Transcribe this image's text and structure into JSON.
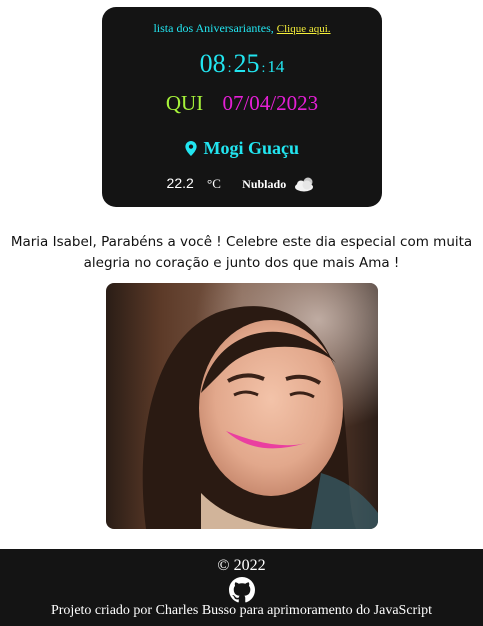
{
  "card": {
    "list_text": "lista dos Aniversariantes,",
    "list_link": "Clique aqui.",
    "clock": {
      "hours": "08",
      "minutes": "25",
      "seconds": "14",
      "separator": ":"
    },
    "weekday": "QUI",
    "date": "07/04/2023",
    "city": "Mogi Guaçu",
    "weather": {
      "temp": "22.2",
      "unit": "°C",
      "condition": "Nublado"
    }
  },
  "message": "Maria Isabel, Parabéns a você ! Celebre este dia especial com muita alegria no coração e junto dos que mais Ama !",
  "footer": {
    "copyright": "© 2022",
    "credit": "Projeto criado por Charles Busso para aprimoramento do JavaScript"
  },
  "colors": {
    "card_bg": "#141414",
    "cyan": "#22e5f0",
    "yellow": "#f5ef3a",
    "green": "#a6f23a",
    "magenta": "#e51fd6"
  }
}
